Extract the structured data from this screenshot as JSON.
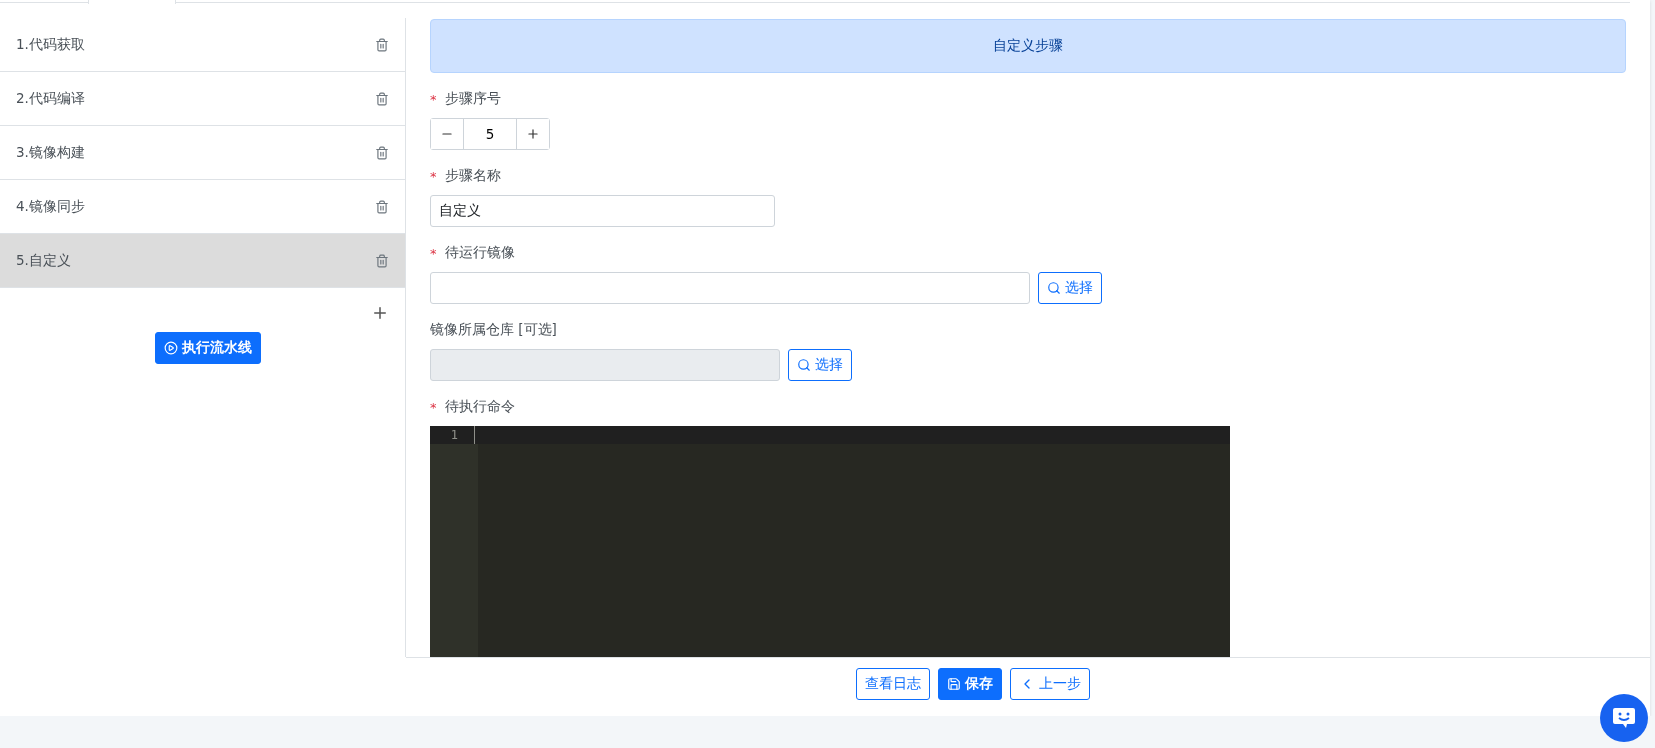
{
  "steps": [
    {
      "label": "1.代码获取",
      "selected": false
    },
    {
      "label": "2.代码编译",
      "selected": false
    },
    {
      "label": "3.镜像构建",
      "selected": false
    },
    {
      "label": "4.镜像同步",
      "selected": false
    },
    {
      "label": "5.自定义",
      "selected": true
    }
  ],
  "run_button": "执行流水线",
  "banner": "自定义步骤",
  "fields": [
    {
      "kind": "stepper",
      "marker": "*",
      "label": "步骤序号",
      "value": "5"
    },
    {
      "kind": "text",
      "marker": "*",
      "label": "步骤名称",
      "value": "自定义"
    },
    {
      "kind": "picker",
      "marker": "*",
      "label": "待运行镜像",
      "disabled": false,
      "button": "选择"
    },
    {
      "kind": "picker",
      "label": "镜像所属仓库 [可选]",
      "disabled": true,
      "button": "选择"
    },
    {
      "kind": "editor",
      "marker": "*",
      "label": "待执行命令",
      "line_numbers": [
        "1"
      ]
    }
  ],
  "footer_buttons": [
    {
      "label": "查看日志",
      "kind": "outline"
    },
    {
      "label": "保存",
      "kind": "save"
    },
    {
      "label": "上一步",
      "kind": "back"
    }
  ]
}
